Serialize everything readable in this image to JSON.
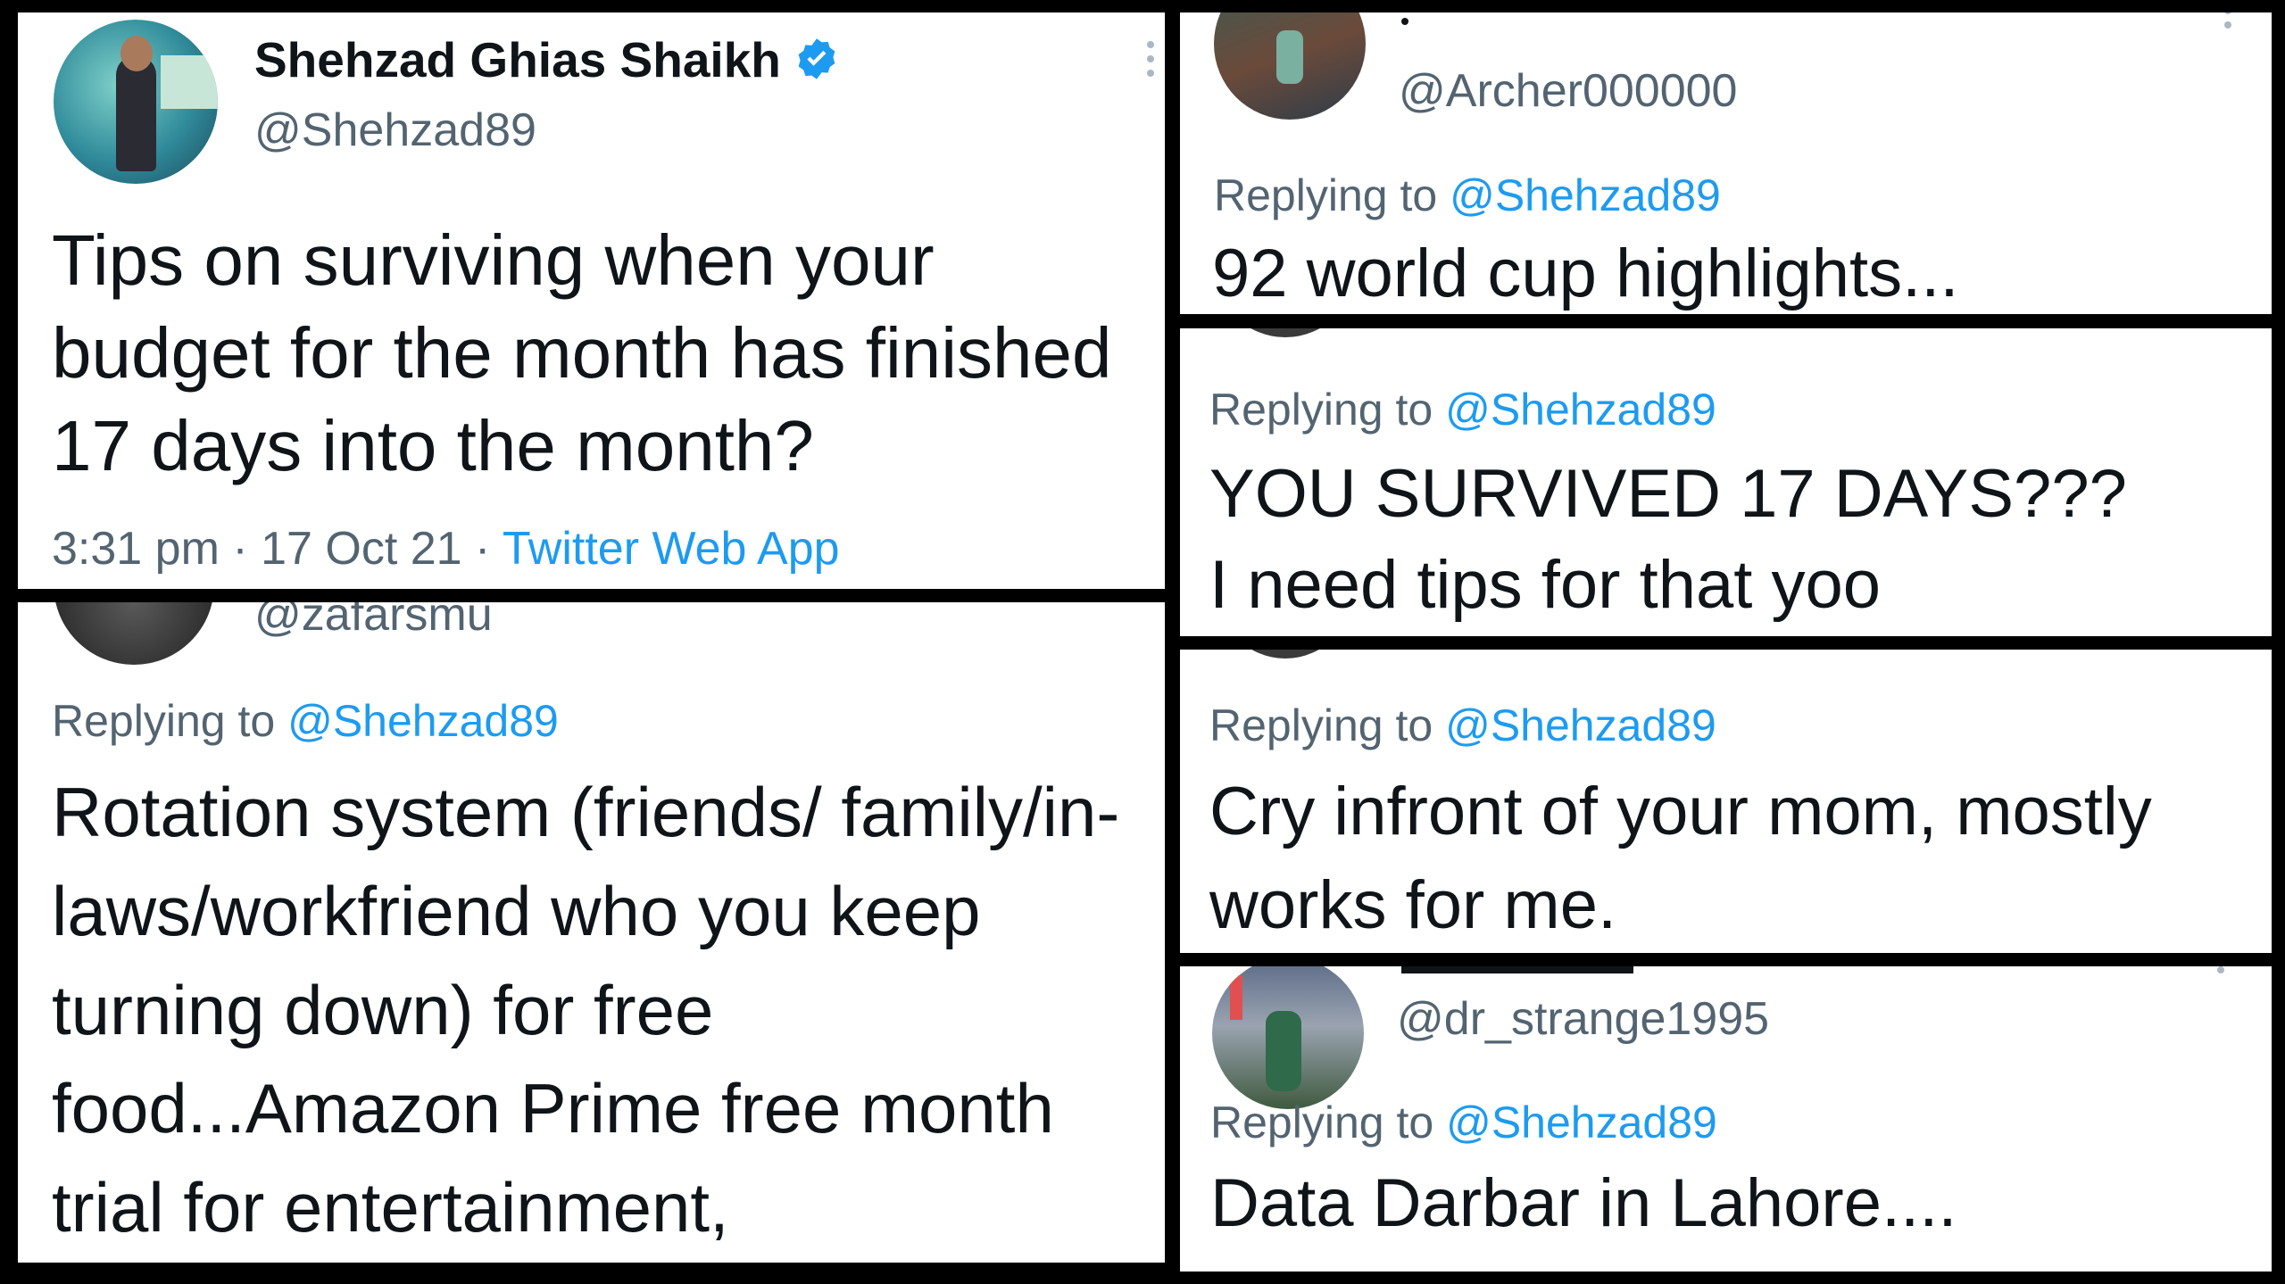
{
  "main_tweet": {
    "author_name": "Shehzad Ghias Shaikh",
    "handle": "@Shehzad89",
    "text": "Tips on surviving when your budget for the month has finished 17 days into the month?",
    "time": "3:31 pm",
    "separator1": "·",
    "date": "17 Oct 21",
    "separator2": "·",
    "app": "Twitter Web App"
  },
  "reply_zafar": {
    "handle": "@zafarsmu",
    "replying_prefix": "Replying to",
    "replying_to": "@Shehzad89",
    "text": "Rotation system (friends/ family/in-laws/workfriend who you keep turning down) for free food...Amazon Prime free month trial for entertainment,"
  },
  "reply_archer": {
    "handle": "@Archer000000",
    "replying_prefix": "Replying to",
    "replying_to": "@Shehzad89",
    "text": "92 world cup highlights..."
  },
  "reply_survived": {
    "replying_prefix": "Replying to",
    "replying_to": "@Shehzad89",
    "line1": "YOU SURVIVED 17 DAYS???",
    "line2": "I need tips for that yoo"
  },
  "reply_cry": {
    "replying_prefix": "Replying to",
    "replying_to": "@Shehzad89",
    "text": "Cry infront of your mom, mostly works for me."
  },
  "reply_data": {
    "handle": "@dr_strange1995",
    "replying_prefix": "Replying to",
    "replying_to": "@Shehzad89",
    "text": "Data Darbar in Lahore...."
  },
  "colors": {
    "link": "#1d9bf0",
    "secondary_text": "#536471",
    "primary_text": "#0f1419",
    "background": "#000000",
    "card": "#ffffff"
  },
  "icons": [
    "verified-badge-icon",
    "more-options-icon"
  ]
}
